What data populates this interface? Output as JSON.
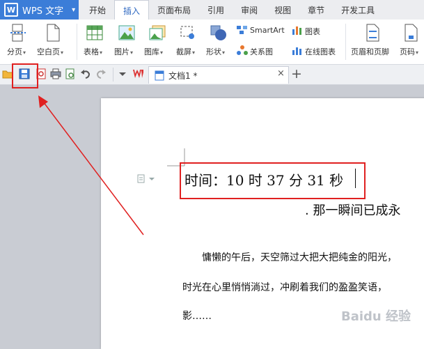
{
  "app": {
    "name": "WPS 文字"
  },
  "tabs": [
    "开始",
    "插入",
    "页面布局",
    "引用",
    "审阅",
    "视图",
    "章节",
    "开发工具"
  ],
  "active_tab": 1,
  "ribbon": {
    "page_break": "分页",
    "blank_page": "空白页",
    "table": "表格",
    "picture": "图片",
    "gallery": "图库",
    "screenshot": "截屏",
    "shape": "形状",
    "smartart": "SmartArt",
    "chart": "图表",
    "relation_chart": "关系图",
    "online_chart": "在线图表",
    "header_footer": "页眉和页脚",
    "page_number": "页码"
  },
  "document": {
    "tab_title": "文档1 *",
    "title_line": "时间：10 时 37 分 31 秒",
    "subtitle": ". 那一瞬间已成永",
    "paragraph": [
      "慵懒的午后，天空筛过大把大把纯金的阳光，",
      "时光在心里悄悄淌过，冲刷着我们的盈盈笑语，",
      "影……"
    ]
  },
  "watermark": "Baidu 经验",
  "colors": {
    "accent": "#3b7dd8",
    "annotation": "#e02020"
  }
}
